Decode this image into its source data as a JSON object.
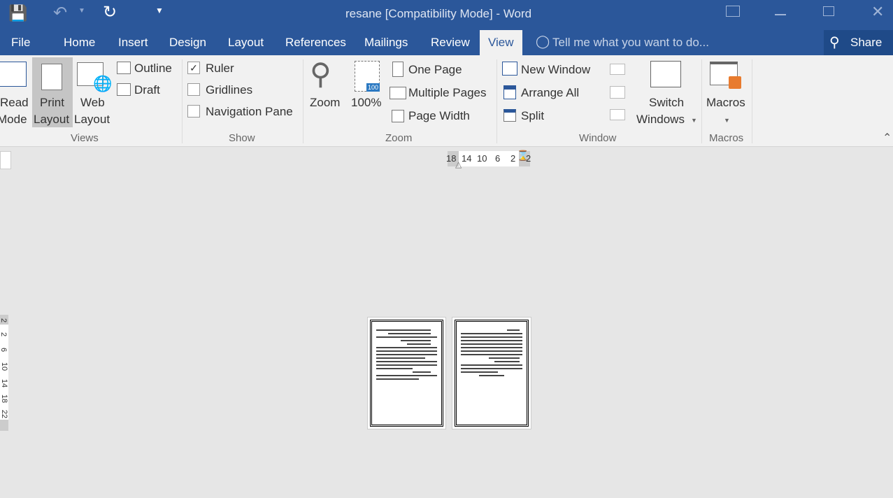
{
  "title": "resane [Compatibility Mode] - Word",
  "qat": {
    "save": "save-icon",
    "undo": "undo-icon",
    "redo": "redo-icon",
    "customize": "customize-icon"
  },
  "tabs": [
    "File",
    "Home",
    "Insert",
    "Design",
    "Layout",
    "References",
    "Mailings",
    "Review",
    "View"
  ],
  "active_tab": "View",
  "tell_me": "Tell me what you want to do...",
  "share": "Share",
  "views": {
    "read_mode": [
      "Read",
      "Mode"
    ],
    "print_layout": [
      "Print",
      "Layout"
    ],
    "web_layout": [
      "Web",
      "Layout"
    ],
    "outline": "Outline",
    "draft": "Draft",
    "group": "Views"
  },
  "show": {
    "ruler": "Ruler",
    "ruler_checked": true,
    "gridlines": "Gridlines",
    "gridlines_checked": false,
    "nav": "Navigation Pane",
    "nav_checked": false,
    "group": "Show"
  },
  "zoom": {
    "zoom": "Zoom",
    "hundred": "100%",
    "badge": "100",
    "one_page": "One Page",
    "multiple_pages": "Multiple Pages",
    "page_width": "Page Width",
    "group": "Zoom"
  },
  "window": {
    "new_window": "New Window",
    "arrange_all": "Arrange All",
    "split": "Split",
    "switch": [
      "Switch",
      "Windows"
    ],
    "group": "Window"
  },
  "macros": {
    "label": "Macros",
    "group": "Macros"
  },
  "ruler": {
    "h": [
      "18",
      "14",
      "10",
      "6",
      "2",
      "2"
    ],
    "v": [
      "2",
      "2",
      "6",
      "10",
      "14",
      "18",
      "22"
    ]
  },
  "colors": {
    "brand": "#2b579a",
    "ribbon": "#f1f1f1",
    "canvas": "#e6e6e6"
  }
}
